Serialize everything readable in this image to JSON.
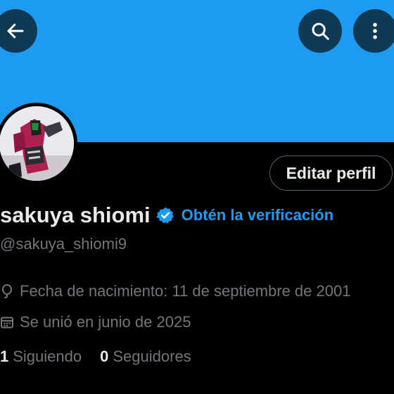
{
  "header": {
    "back_icon": "arrow-left-icon",
    "search_icon": "search-icon",
    "more_icon": "more-vertical-icon"
  },
  "colors": {
    "banner": "#1d9bf0",
    "accent": "#1d9bf0",
    "background": "#000000",
    "text_primary": "#e7e9ea",
    "text_secondary": "#71767b"
  },
  "profile": {
    "display_name": "sakuya shiomi",
    "verified_badge_icon": "verified-badge-icon",
    "verify_link": "Obtén la verificación",
    "handle": "@sakuya_shiomi9",
    "edit_button": "Editar perfil",
    "birthdate_icon": "balloon-icon",
    "birthdate": "Fecha de nacimiento: 11 de septiembre de 2001",
    "joined_icon": "calendar-icon",
    "joined": "Se unió en junio de 2025",
    "following_count": "1",
    "following_label": "Siguiendo",
    "followers_count": "0",
    "followers_label": "Seguidores"
  }
}
